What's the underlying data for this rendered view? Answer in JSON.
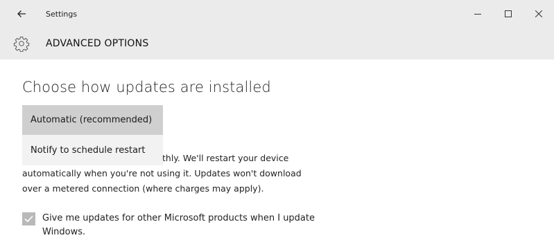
{
  "window": {
    "title": "Settings",
    "back_icon": "back-arrow-icon",
    "controls": {
      "minimize_icon": "minimize-icon",
      "maximize_icon": "maximize-icon",
      "close_icon": "close-icon"
    }
  },
  "header": {
    "icon": "gear-icon",
    "title": "ADVANCED OPTIONS"
  },
  "main": {
    "heading": "Choose how updates are installed",
    "dropdown": {
      "options": [
        {
          "label": "Automatic (recommended)",
          "selected": true
        },
        {
          "label": "Notify to schedule restart",
          "selected": false
        }
      ]
    },
    "description_lines": [
      "thly. We'll restart your device",
      "automatically when you're not using it. Updates won't download",
      "over a metered connection (where charges may apply)."
    ],
    "checkbox": {
      "checked": true,
      "label_lines": [
        "Give me updates for other Microsoft products when I update",
        "Windows."
      ]
    }
  },
  "colors": {
    "header_bg": "#ebebeb",
    "dropdown_bg": "#f2f2f2",
    "dropdown_selected_bg": "#cfcfcf",
    "checkbox_bg": "#b9b9b9"
  }
}
